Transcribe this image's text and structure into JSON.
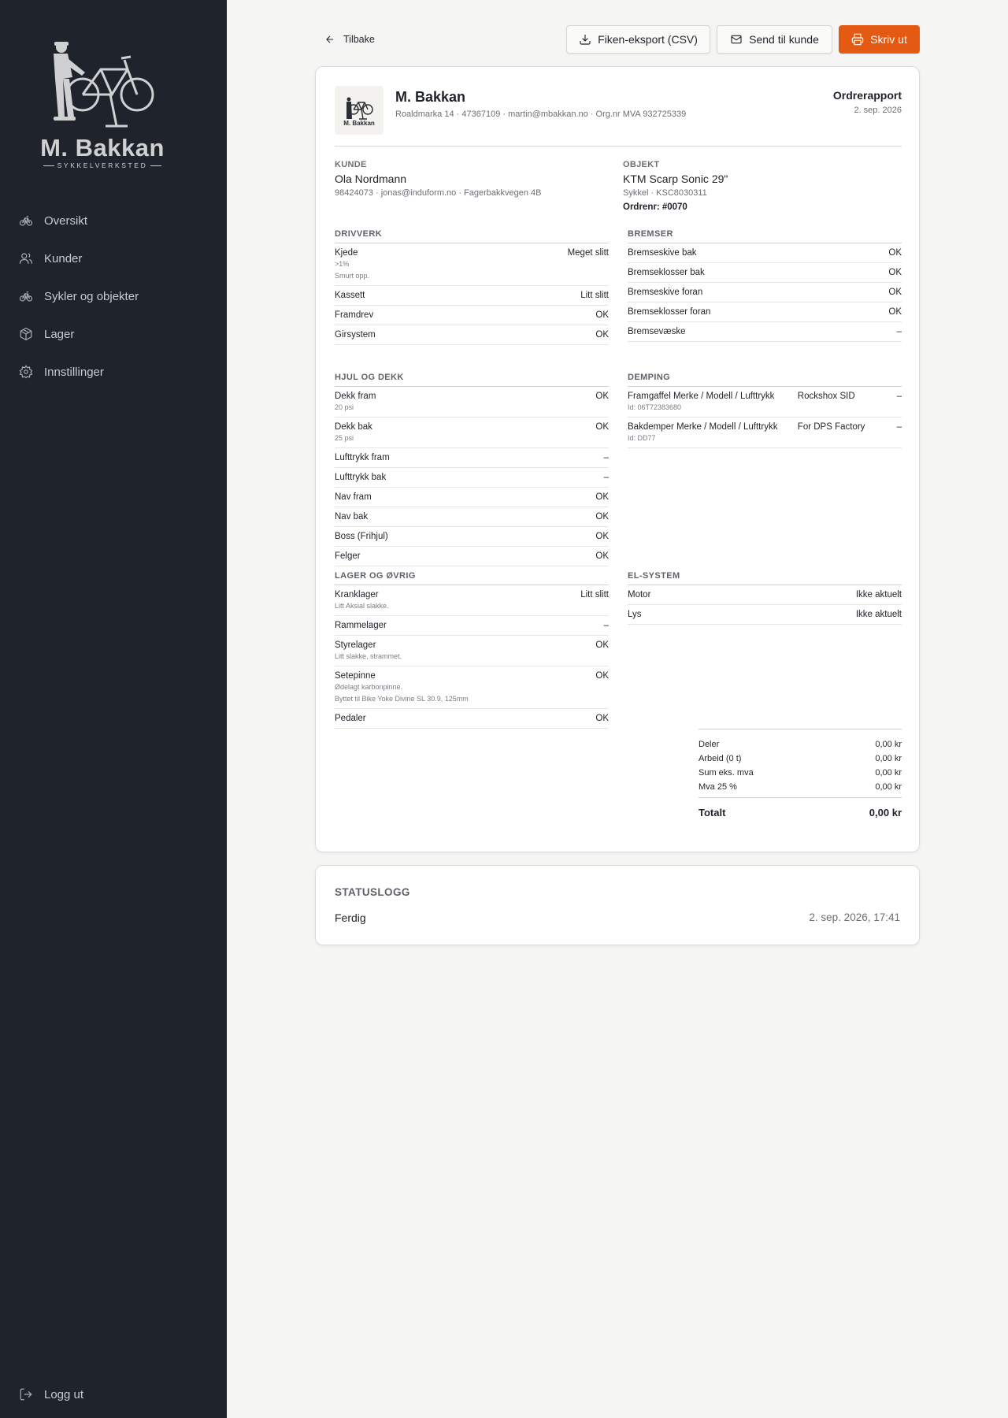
{
  "brand": {
    "name": "M. Bakkan",
    "subtitle": "SYKKELVERKSTED"
  },
  "nav": {
    "items": [
      {
        "label": "Oversikt",
        "icon": "bike-icon"
      },
      {
        "label": "Kunder",
        "icon": "users-icon"
      },
      {
        "label": "Sykler og objekter",
        "icon": "bike-icon"
      },
      {
        "label": "Lager",
        "icon": "box-icon"
      },
      {
        "label": "Innstillinger",
        "icon": "gear-icon"
      }
    ],
    "logout": "Logg ut"
  },
  "toolbar": {
    "back": "Tilbake",
    "csv": "Fiken-eksport (CSV)",
    "send": "Send til kunde",
    "print": "Skriv ut",
    "accent": "#e45a12"
  },
  "report": {
    "company_name": "M. Bakkan",
    "company_info": "Roaldmarka 14 · 47367109 · martin@mbakkan.no · Org.nr MVA 932725339",
    "title": "Ordrerapport",
    "date": "2. sep. 2026",
    "customer": {
      "label": "KUNDE",
      "name": "Ola Nordmann",
      "info": "98424073 · jonas@induform.no · Fagerbakkvegen 4B"
    },
    "object": {
      "label": "OBJEKT",
      "name": "KTM Scarp Sonic 29\"",
      "info": "Sykkel · KSC8030311",
      "order_no": "Ordrenr: #0070"
    },
    "sections": {
      "drivverk": {
        "title": "DRIVVERK",
        "rows": [
          {
            "k": "Kjede",
            "v": "Meget slitt",
            "n1": ">1%",
            "n2": "Smurt opp."
          },
          {
            "k": "Kassett",
            "v": "Litt slitt"
          },
          {
            "k": "Framdrev",
            "v": "OK"
          },
          {
            "k": "Girsystem",
            "v": "OK"
          }
        ]
      },
      "bremser": {
        "title": "BREMSER",
        "rows": [
          {
            "k": "Bremseskive bak",
            "v": "OK"
          },
          {
            "k": "Bremseklosser bak",
            "v": "OK"
          },
          {
            "k": "Bremseskive foran",
            "v": "OK"
          },
          {
            "k": "Bremseklosser foran",
            "v": "OK"
          },
          {
            "k": "Bremsevæske",
            "v": "–"
          }
        ]
      },
      "hjul": {
        "title": "HJUL OG DEKK",
        "rows": [
          {
            "k": "Dekk fram",
            "v": "OK",
            "n1": "20 psi"
          },
          {
            "k": "Dekk bak",
            "v": "OK",
            "n1": "25 psi"
          },
          {
            "k": "Lufttrykk fram",
            "v": "–"
          },
          {
            "k": "Lufttrykk bak",
            "v": "–"
          },
          {
            "k": "Nav fram",
            "v": "OK"
          },
          {
            "k": "Nav bak",
            "v": "OK"
          },
          {
            "k": "Boss (Frihjul)",
            "v": "OK"
          },
          {
            "k": "Felger",
            "v": "OK"
          }
        ]
      },
      "demping": {
        "title": "DEMPING",
        "rows": [
          {
            "k": "Framgaffel Merke / Modell / Lufttrykk",
            "m": "Rockshox SID",
            "v": "–",
            "n1": "Id: 06T72383680"
          },
          {
            "k": "Bakdemper Merke / Modell / Lufttrykk",
            "m": "For DPS Factory",
            "v": "–",
            "n1": "Id: DD77"
          }
        ]
      },
      "lager": {
        "title": "LAGER OG ØVRIG",
        "rows": [
          {
            "k": "Kranklager",
            "v": "Litt slitt",
            "n1": "Litt Aksial slakke."
          },
          {
            "k": "Rammelager",
            "v": "–"
          },
          {
            "k": "Styrelager",
            "v": "OK",
            "n1": "Litt slakke, strammet."
          },
          {
            "k": "Setepinne",
            "v": "OK",
            "n1": "Ødelagt karbonpinne.",
            "n2": "Byttet til Bike Yoke Divine SL 30.9, 125mm"
          },
          {
            "k": "Pedaler",
            "v": "OK"
          }
        ]
      },
      "el": {
        "title": "EL-SYSTEM",
        "rows": [
          {
            "k": "Motor",
            "v": "Ikke aktuelt"
          },
          {
            "k": "Lys",
            "v": "Ikke aktuelt"
          }
        ]
      }
    },
    "totals": {
      "deler": {
        "k": "Deler",
        "v": "0,00 kr"
      },
      "arbeid": {
        "k": "Arbeid (0 t)",
        "v": "0,00 kr"
      },
      "sum": {
        "k": "Sum eks. mva",
        "v": "0,00 kr"
      },
      "mva": {
        "k": "Mva 25 %",
        "v": "0,00 kr"
      },
      "total": {
        "k": "Totalt",
        "v": "0,00 kr"
      }
    }
  },
  "statuslog": {
    "title": "STATUSLOGG",
    "entries": [
      {
        "status": "Ferdig",
        "time": "2. sep. 2026, 17:41"
      }
    ]
  }
}
